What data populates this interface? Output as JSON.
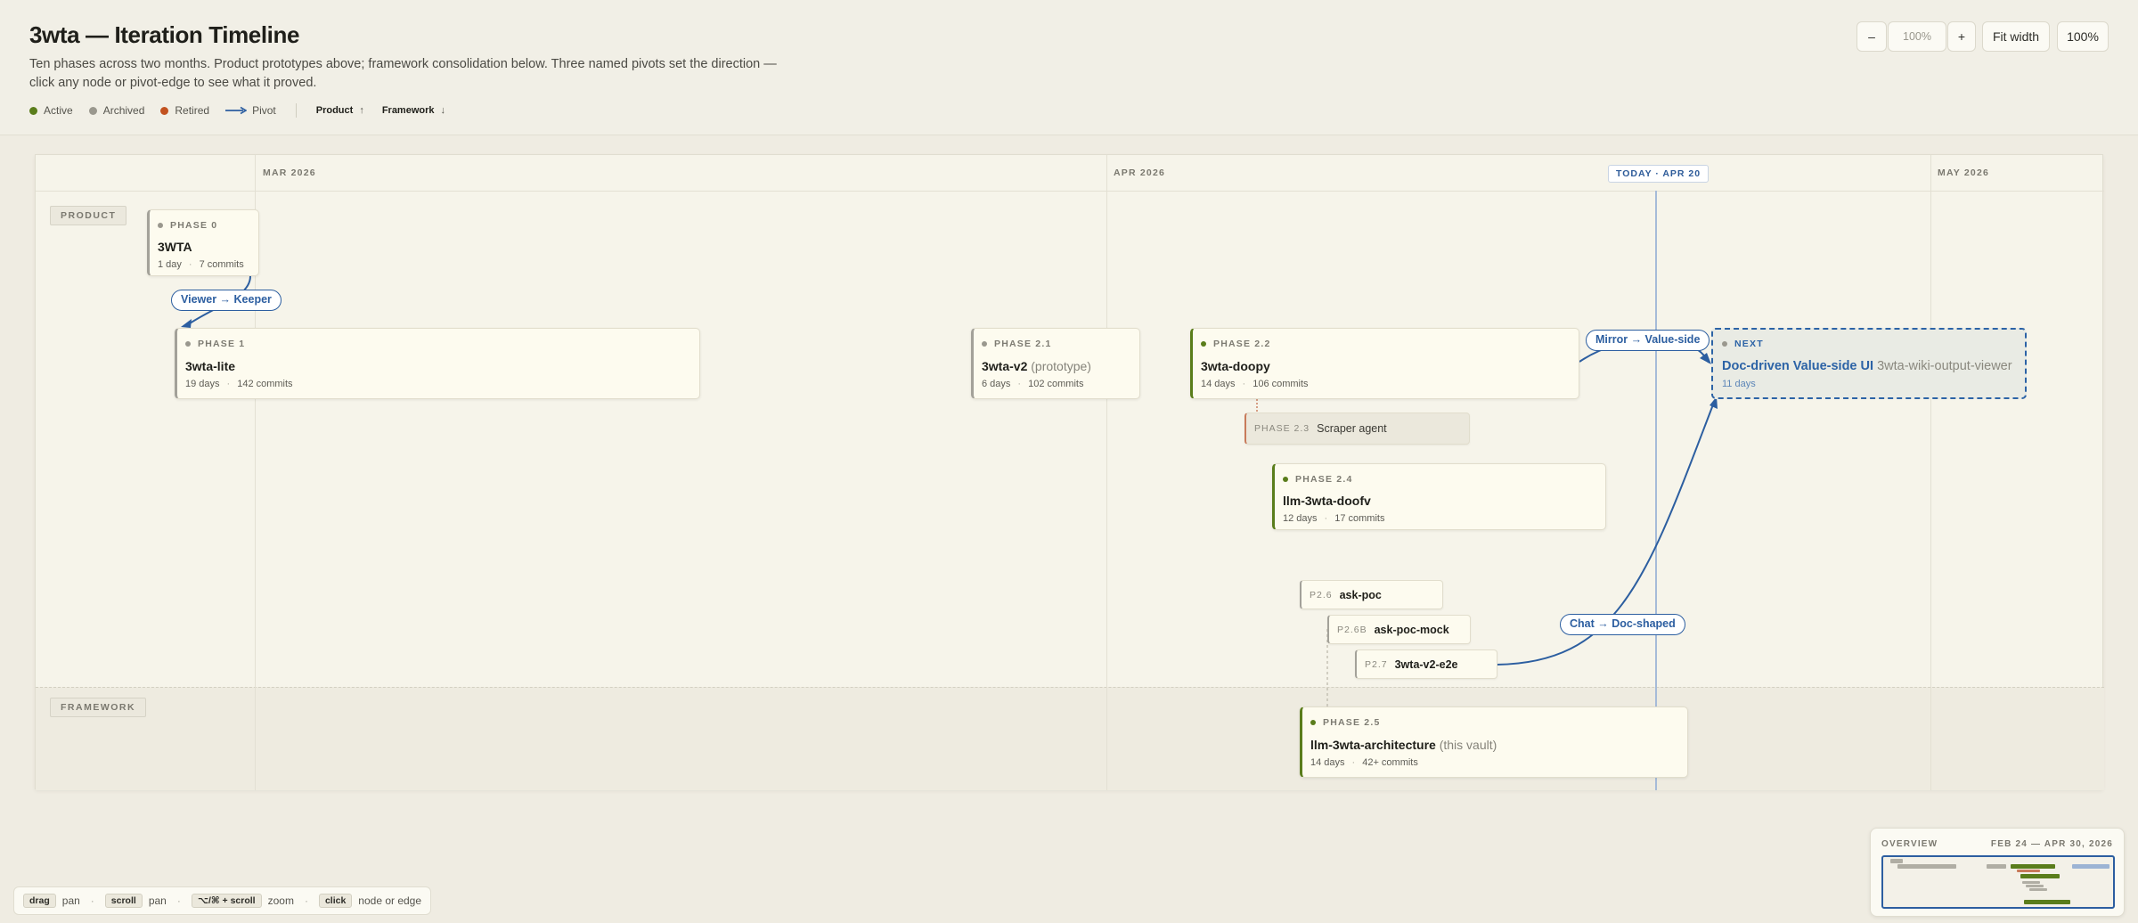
{
  "header": {
    "title": "3wta — Iteration Timeline",
    "subtitle": "Ten phases across two months. Product prototypes above; framework consolidation below. Three named pivots set the direction — click any node or pivot-edge to see what it proved."
  },
  "legend": {
    "active": "Active",
    "archived": "Archived",
    "retired": "Retired",
    "pivot": "Pivot",
    "product": "Product",
    "product_arrow": "↑",
    "framework": "Framework",
    "framework_arrow": "↓",
    "colors": {
      "active": "#5a7d1b",
      "archived": "#9a988e",
      "retired": "#c2521f",
      "pivot": "#2c5ea0"
    }
  },
  "zoom": {
    "minus": "–",
    "value": "100%",
    "plus": "+",
    "fit": "Fit width",
    "reset": "100%"
  },
  "timeline": {
    "months": {
      "mar": "MAR 2026",
      "apr": "APR 2026",
      "may": "MAY 2026"
    },
    "today": "TODAY · APR 20",
    "lanes": {
      "product": "PRODUCT",
      "framework": "FRAMEWORK"
    }
  },
  "nodes": {
    "p0": {
      "tag": "PHASE 0",
      "title": "3WTA",
      "qual": "",
      "days": "1 day",
      "commits": "7 commits",
      "status": "archived"
    },
    "p1": {
      "tag": "PHASE 1",
      "title": "3wta-lite",
      "qual": "",
      "days": "19 days",
      "commits": "142 commits",
      "status": "archived"
    },
    "p21": {
      "tag": "PHASE 2.1",
      "title": "3wta-v2",
      "qual": "(prototype)",
      "days": "6 days",
      "commits": "102 commits",
      "status": "archived"
    },
    "p22": {
      "tag": "PHASE 2.2",
      "title": "3wta-doopy",
      "qual": "",
      "days": "14 days",
      "commits": "106 commits",
      "status": "active"
    },
    "p23": {
      "tag": "PHASE 2.3",
      "title": "Scraper agent",
      "status": "retired"
    },
    "p24": {
      "tag": "PHASE 2.4",
      "title": "llm-3wta-doofv",
      "qual": "",
      "days": "12 days",
      "commits": "17 commits",
      "status": "active"
    },
    "p25": {
      "tag": "PHASE 2.5",
      "title": "llm-3wta-architecture",
      "qual": "(this vault)",
      "days": "14 days",
      "commits": "42+ commits",
      "status": "active"
    },
    "p26": {
      "tag": "P2.6",
      "title": "ask-poc"
    },
    "p26b": {
      "tag": "P2.6B",
      "title": "ask-poc-mock"
    },
    "p27": {
      "tag": "P2.7",
      "title": "3wta-v2-e2e"
    },
    "next": {
      "tag": "NEXT",
      "title": "Doc-driven Value-side UI",
      "qual": "3wta-wiki-output-viewer",
      "days": "11 days"
    }
  },
  "pivots": {
    "viewer_keeper": "Viewer → Keeper",
    "mirror_value": "Mirror → Value-side",
    "chat_doc": "Chat → Doc-shaped"
  },
  "hints": {
    "drag_key": "drag",
    "drag_label": "pan",
    "scroll_key": "scroll",
    "scroll_label": "pan",
    "zoom_key": "⌥/⌘ + scroll",
    "zoom_label": "zoom",
    "click_key": "click",
    "click_label": "node or edge",
    "sep": "·"
  },
  "overview": {
    "title": "OVERVIEW",
    "range": "FEB 24 — APR 30, 2026"
  }
}
